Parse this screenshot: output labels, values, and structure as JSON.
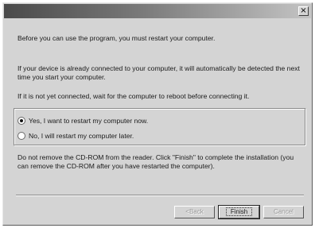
{
  "dialog": {
    "close_glyph": "×",
    "paragraphs": {
      "intro": "Before you can use the program, you must restart your computer.",
      "connected": "If your device is already connected to your computer, it will automatically be detected the next time you start your computer.",
      "not_connected": "If it is not yet connected, wait for the computer to reboot before connecting it.",
      "cdrom": "Do not remove the CD-ROM from the reader. Click \"Finish\" to complete the installation (you can remove the CD-ROM after you have restarted the computer)."
    },
    "options": [
      {
        "label": "Yes, I want to restart my computer now.",
        "checked": true
      },
      {
        "label": "No, I will restart my computer later.",
        "checked": false
      }
    ],
    "buttons": {
      "back": "<Back",
      "finish": "Finish",
      "cancel": "Cancel"
    }
  }
}
